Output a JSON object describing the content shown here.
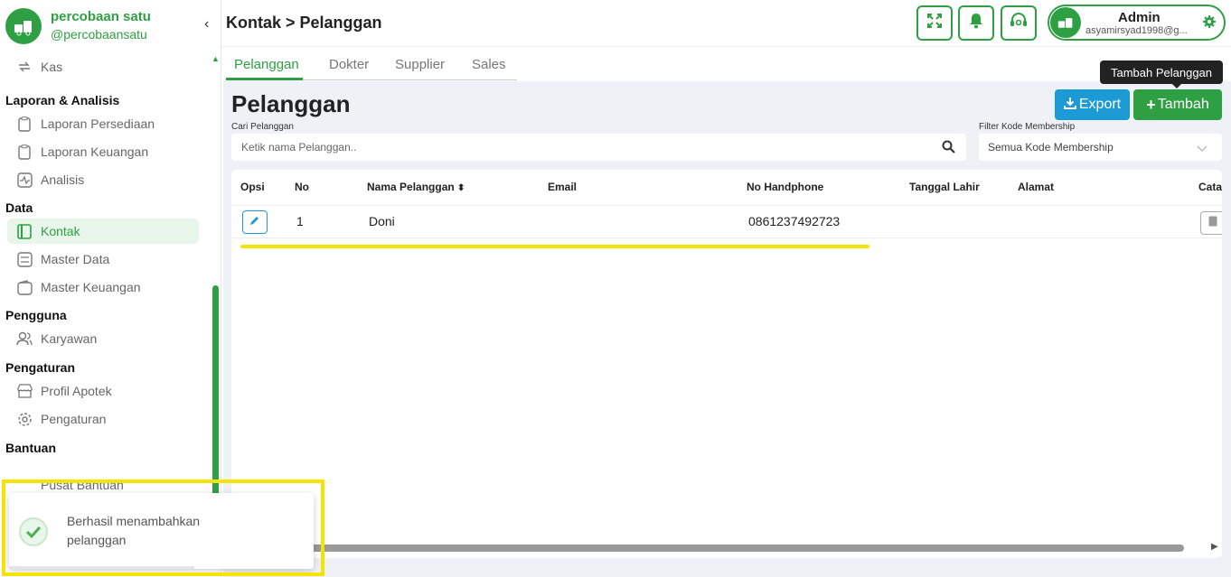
{
  "brand": {
    "name": "percobaan satu",
    "handle": "@percobaansatu"
  },
  "sidebar": {
    "collapse": "‹",
    "top_item": "Kas",
    "sections": [
      {
        "title": "Laporan & Analisis",
        "items": [
          "Laporan Persediaan",
          "Laporan Keuangan",
          "Analisis"
        ]
      },
      {
        "title": "Data",
        "items": [
          "Kontak",
          "Master Data",
          "Master Keuangan"
        ]
      },
      {
        "title": "Pengguna",
        "items": [
          "Karyawan"
        ]
      },
      {
        "title": "Pengaturan",
        "items": [
          "Profil Apotek",
          "Pengaturan"
        ]
      },
      {
        "title": "Bantuan",
        "items": [
          "Pusat Bantuan"
        ]
      }
    ],
    "active_item": "Kontak"
  },
  "header": {
    "breadcrumb": "Kontak > Pelanggan",
    "user": {
      "name": "Admin",
      "email": "asyamirsyad1998@g..."
    }
  },
  "tabs": [
    "Pelanggan",
    "Dokter",
    "Supplier",
    "Sales"
  ],
  "main": {
    "title": "Pelanggan",
    "export_label": "Export",
    "add_label": "Tambah",
    "tooltip": "Tambah Pelanggan",
    "search_label": "Cari Pelanggan",
    "search_placeholder": "Ketik nama Pelanggan..",
    "filter_label": "Filter Kode Membership",
    "filter_value": "Semua Kode Membership"
  },
  "table": {
    "columns": [
      "Opsi",
      "No",
      "Nama Pelanggan",
      "Email",
      "No Handphone",
      "Tanggal Lahir",
      "Alamat",
      "Cata"
    ],
    "rows": [
      {
        "no": "1",
        "nama": "Doni",
        "email": "",
        "hp": "0861237492723",
        "tgl": "",
        "alamat": ""
      }
    ]
  },
  "toast": {
    "message": "Berhasil menambahkan pelanggan"
  },
  "colors": {
    "accent": "#2ea043",
    "export": "#1c9ad6",
    "highlight": "#f5e400"
  },
  "icons": [
    "fullscreen-icon",
    "bell-icon",
    "headset-icon",
    "gear-icon",
    "search-icon",
    "chevron-down-icon",
    "edit-icon",
    "note-icon",
    "check-icon",
    "download-icon",
    "plus-icon"
  ]
}
